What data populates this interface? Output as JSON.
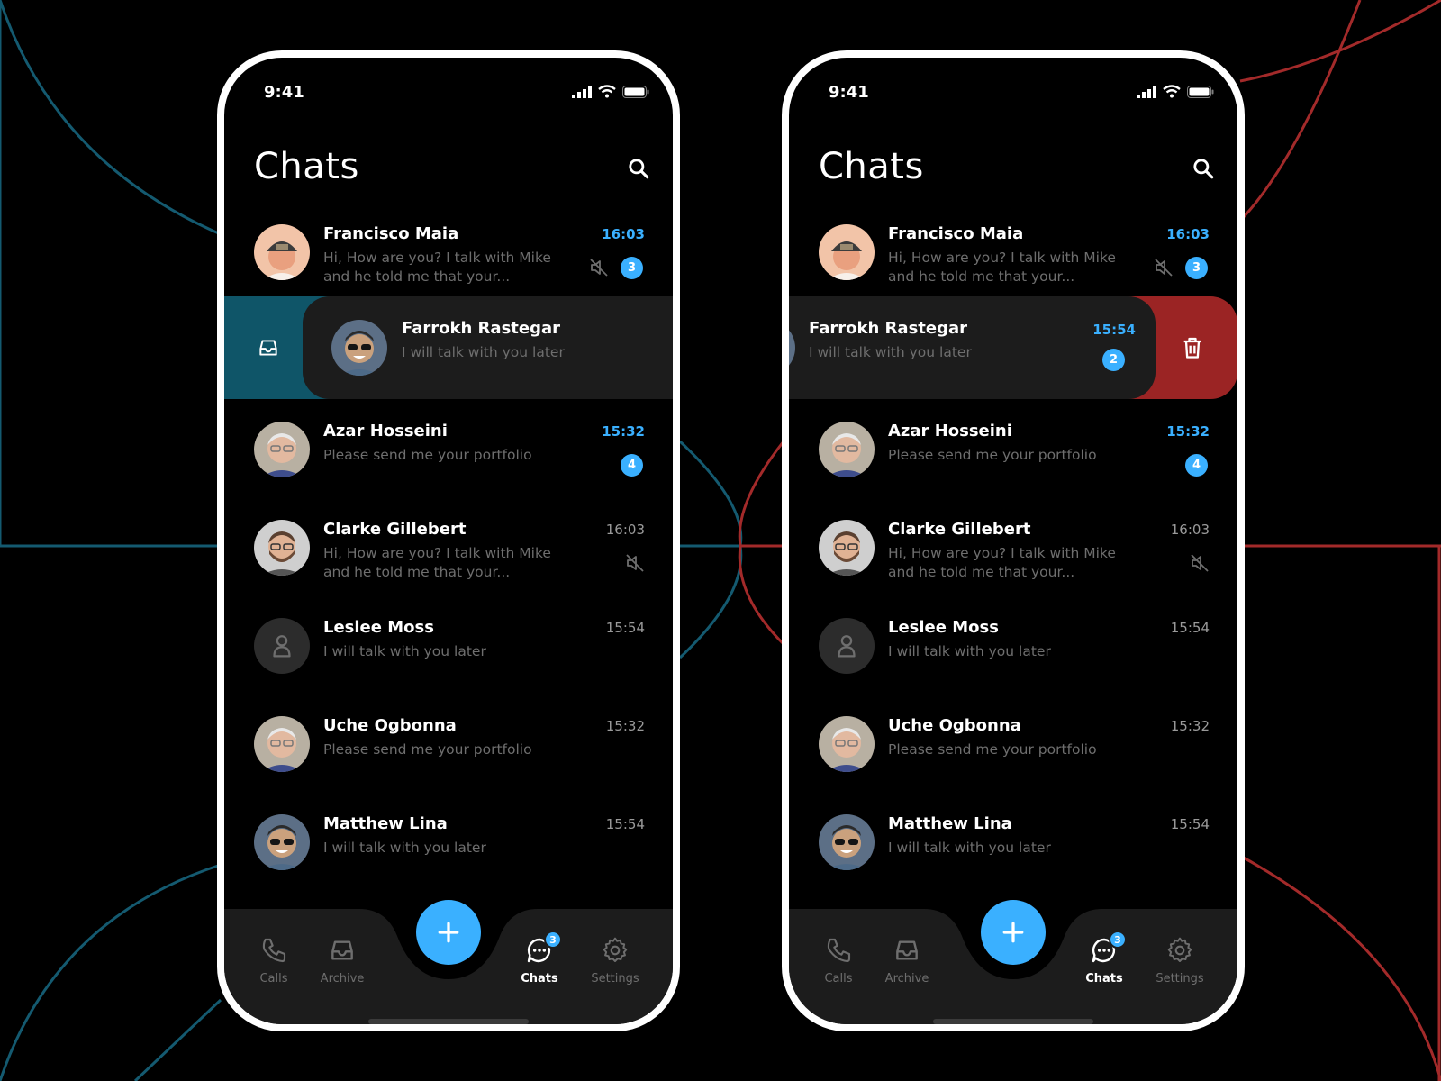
{
  "colors": {
    "accent": "#3ab0ff",
    "archive_action": "#0f5568",
    "delete_action": "#9b2424",
    "line_teal": "#145a70",
    "line_red": "#a32a2a"
  },
  "phones": [
    {
      "status_time": "9:41",
      "title": "Chats",
      "swiped_direction": "right",
      "swiped_row": {
        "name": "Farrokh Rastegar",
        "preview": "I will talk with you later",
        "action_icon": "archive-icon"
      },
      "chats": [
        {
          "name": "Francisco Maia",
          "preview": "Hi, How are you? I talk with Mike and he told me that your...",
          "time": "16:03",
          "time_accent": true,
          "muted": true,
          "badge": "3"
        },
        {
          "name": "Azar Hosseini",
          "preview": "Please send me your portfolio",
          "time": "15:32",
          "time_accent": true,
          "muted": false,
          "badge": "4"
        },
        {
          "name": "Clarke Gillebert",
          "preview": "Hi, How are you? I talk with Mike and he told me that your...",
          "time": "16:03",
          "time_accent": false,
          "muted": true,
          "badge": ""
        },
        {
          "name": "Leslee Moss",
          "preview": "I will talk with you later",
          "time": "15:54",
          "time_accent": false,
          "muted": false,
          "badge": ""
        },
        {
          "name": "Uche Ogbonna",
          "preview": "Please send me your portfolio",
          "time": "15:32",
          "time_accent": false,
          "muted": false,
          "badge": ""
        },
        {
          "name": "Matthew Lina",
          "preview": "I will talk with you later",
          "time": "15:54",
          "time_accent": false,
          "muted": false,
          "badge": ""
        }
      ],
      "tabs": {
        "calls": "Calls",
        "archive": "Archive",
        "chats": "Chats",
        "settings": "Settings",
        "chats_badge": "3"
      }
    },
    {
      "status_time": "9:41",
      "title": "Chats",
      "swiped_direction": "left",
      "swiped_row": {
        "name": "Farrokh Rastegar",
        "preview": "I will talk with you later",
        "time": "15:54",
        "badge": "2",
        "action_icon": "trash-icon"
      },
      "chats": [
        {
          "name": "Francisco Maia",
          "preview": "Hi, How are you? I talk with Mike and he told me that your...",
          "time": "16:03",
          "time_accent": true,
          "muted": true,
          "badge": "3"
        },
        {
          "name": "Azar Hosseini",
          "preview": "Please send me your portfolio",
          "time": "15:32",
          "time_accent": true,
          "muted": false,
          "badge": "4"
        },
        {
          "name": "Clarke Gillebert",
          "preview": "Hi, How are you? I talk with Mike and he told me that your...",
          "time": "16:03",
          "time_accent": false,
          "muted": true,
          "badge": ""
        },
        {
          "name": "Leslee Moss",
          "preview": "I will talk with you later",
          "time": "15:54",
          "time_accent": false,
          "muted": false,
          "badge": ""
        },
        {
          "name": "Uche Ogbonna",
          "preview": "Please send me your portfolio",
          "time": "15:32",
          "time_accent": false,
          "muted": false,
          "badge": ""
        },
        {
          "name": "Matthew Lina",
          "preview": "I will talk with you later",
          "time": "15:54",
          "time_accent": false,
          "muted": false,
          "badge": ""
        }
      ],
      "tabs": {
        "calls": "Calls",
        "archive": "Archive",
        "chats": "Chats",
        "settings": "Settings",
        "chats_badge": "3"
      }
    }
  ]
}
